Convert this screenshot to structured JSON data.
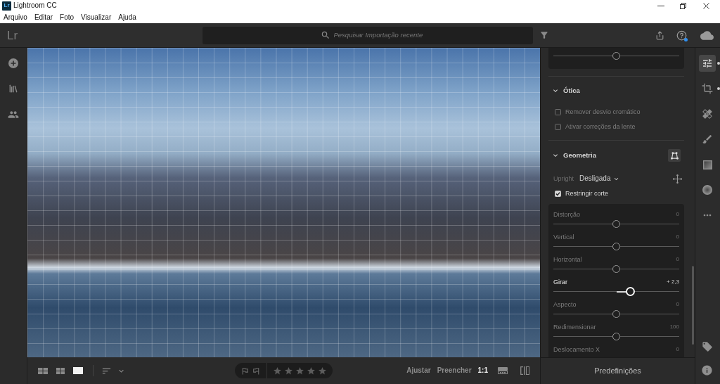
{
  "window": {
    "icon_label": "Lr",
    "title": "Lightroom CC"
  },
  "menu": [
    "Arquivo",
    "Editar",
    "Foto",
    "Visualizar",
    "Ajuda"
  ],
  "toolbar": {
    "logo": "Lr",
    "search": {
      "placeholder": "Pesquisar Importação recente"
    },
    "help_notification": true
  },
  "bottom_bar": {
    "views": [
      {
        "kind": "large-grid",
        "selected": false
      },
      {
        "kind": "small-grid",
        "selected": false
      },
      {
        "kind": "single",
        "selected": true
      }
    ],
    "flags": [
      {
        "kind": "pick",
        "selected": false
      },
      {
        "kind": "reject",
        "selected": false
      }
    ],
    "rating": {
      "stars": 0
    },
    "zoom": [
      {
        "label": "Ajustar",
        "selected": false
      },
      {
        "label": "Preencher",
        "selected": false
      },
      {
        "label": "1:1",
        "selected": true
      }
    ]
  },
  "edit_panel": {
    "top_slider": {
      "level": 0.5
    },
    "optics": {
      "title": "Ótica",
      "expanded": true,
      "options": [
        {
          "label": "Remover desvio cromático",
          "checked": false,
          "disabled": true
        },
        {
          "label": "Ativar correções da lente",
          "checked": false,
          "disabled": true
        }
      ]
    },
    "geometry": {
      "title": "Geometria",
      "expanded": true,
      "upright": {
        "label": "Upright",
        "value": "Desligada"
      },
      "options": [
        {
          "label": "Restringir corte",
          "checked": true,
          "disabled": false
        }
      ],
      "sliders": [
        {
          "label": "Distorção",
          "reading": "0",
          "level": 0.5,
          "active": false
        },
        {
          "label": "Vertical",
          "reading": "0",
          "level": 0.5,
          "active": false
        },
        {
          "label": "Horizontal",
          "reading": "0",
          "level": 0.5,
          "active": false
        },
        {
          "label": "Girar",
          "reading": "+ 2,3",
          "level": 0.61,
          "active": true
        },
        {
          "label": "Aspecto",
          "reading": "0",
          "level": 0.5,
          "active": false
        },
        {
          "label": "Redimensionar",
          "reading": "100",
          "level": 0.5,
          "active": false
        },
        {
          "label": "Deslocamento X",
          "reading": "0",
          "active": false
        }
      ]
    }
  },
  "presets_button": "Predefinições",
  "right_toolbar": {
    "tools": [
      {
        "kind": "sliders",
        "selected": true,
        "edited": true
      },
      {
        "kind": "crop",
        "selected": false,
        "edited": true
      },
      {
        "kind": "healing",
        "selected": false,
        "edited": false
      },
      {
        "kind": "brush",
        "selected": false,
        "edited": false
      },
      {
        "kind": "linear",
        "selected": false,
        "edited": false
      },
      {
        "kind": "radial",
        "selected": false,
        "edited": false
      },
      {
        "kind": "more",
        "selected": false,
        "edited": false
      }
    ],
    "bottom_tools": [
      {
        "kind": "tag"
      },
      {
        "kind": "info"
      }
    ]
  }
}
